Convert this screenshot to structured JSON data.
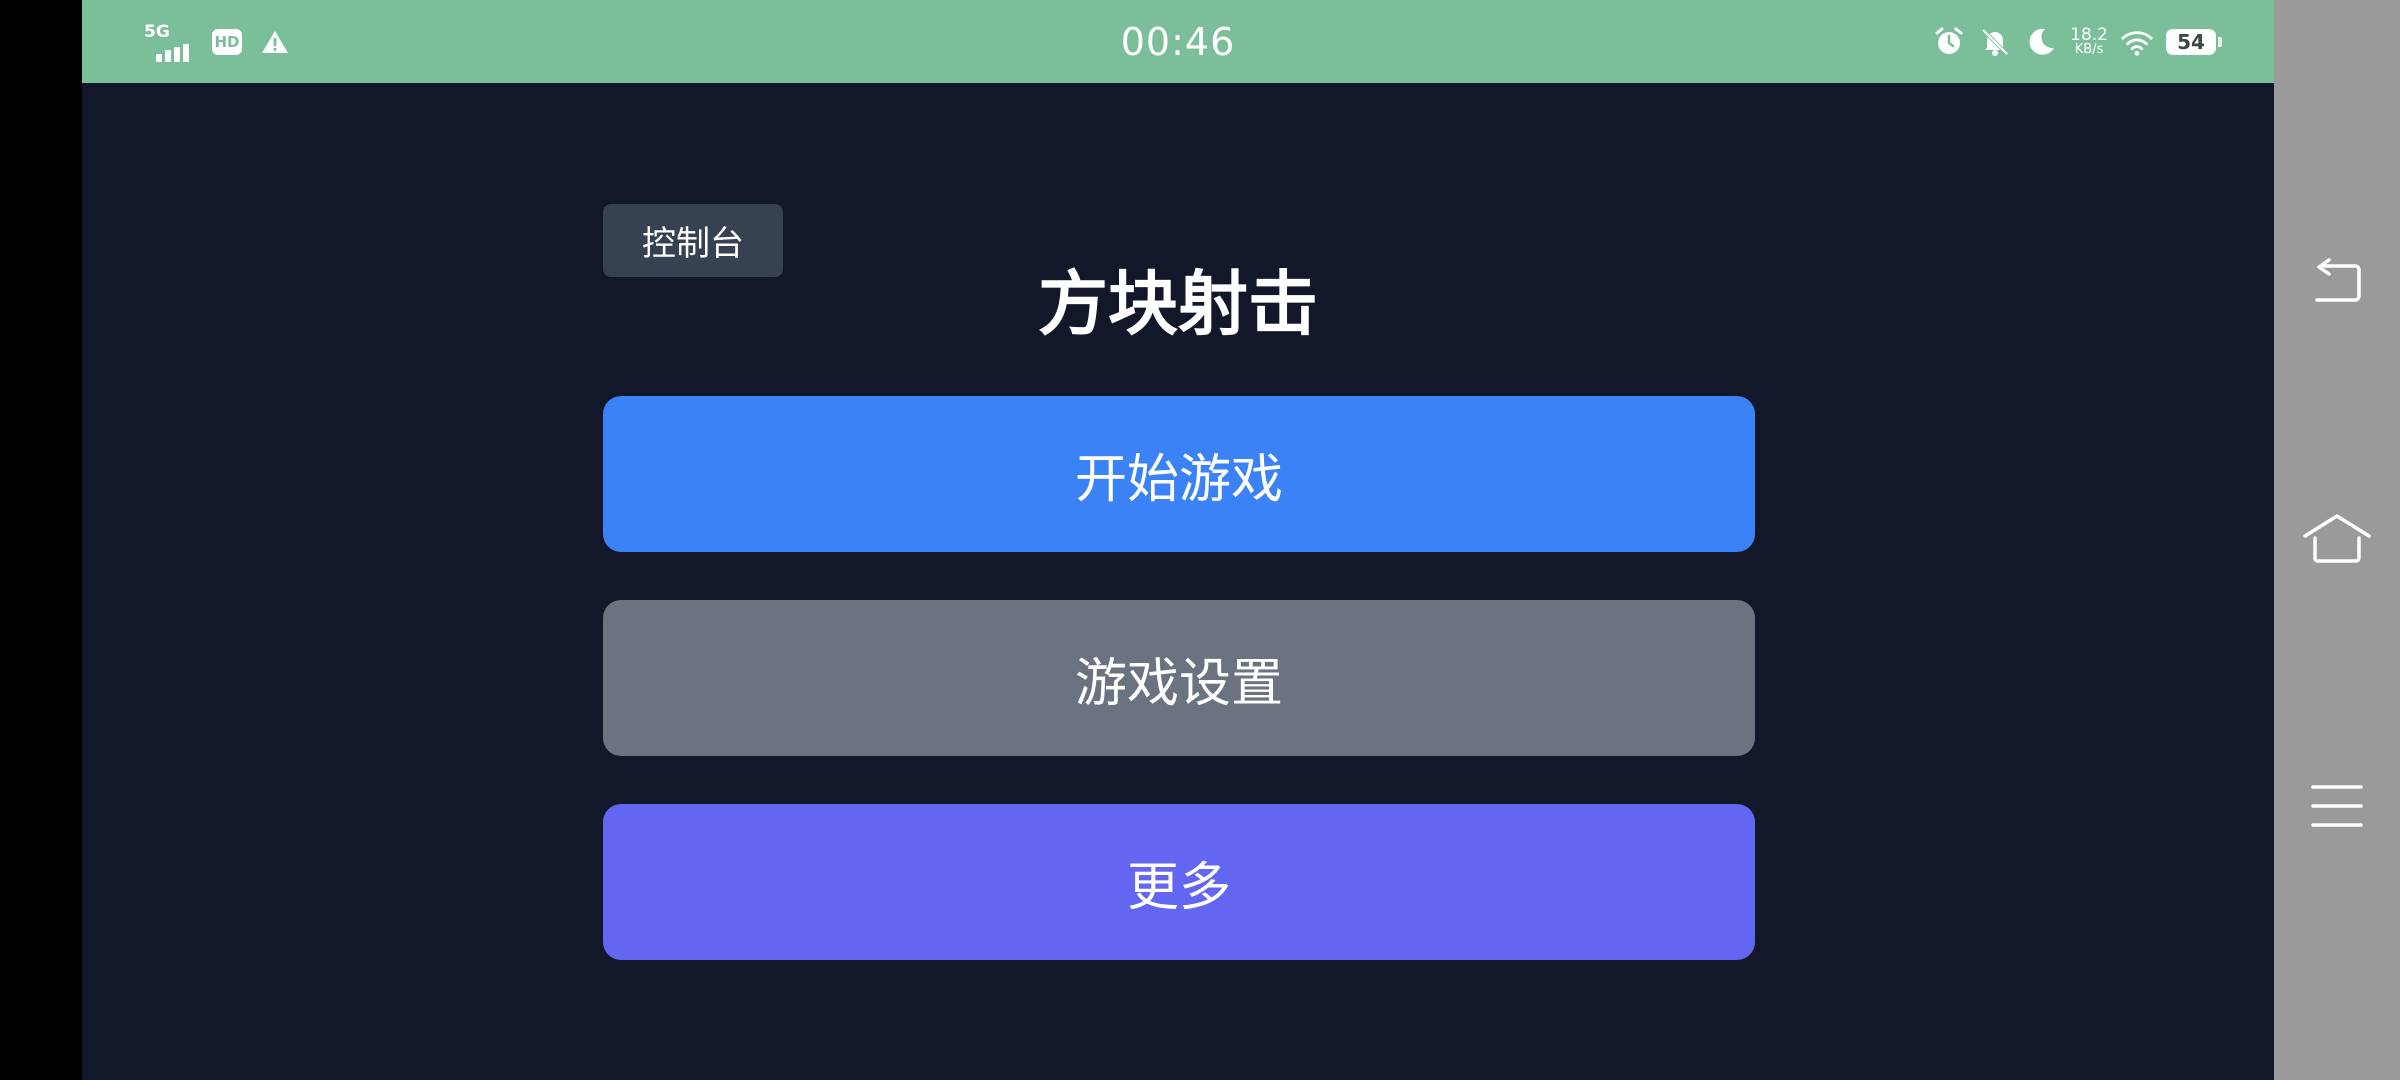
{
  "status_bar": {
    "network": "5G",
    "hd_badge": "HD",
    "time": "00:46",
    "speed_value": "18.2",
    "speed_unit": "KB/s",
    "battery": "54",
    "icons": [
      "signal-icon",
      "hd-icon",
      "warning-icon",
      "alarm-icon",
      "mute-notifications-icon",
      "do-not-disturb-moon-icon",
      "wifi-icon",
      "battery-icon"
    ]
  },
  "app": {
    "console_label": "控制台",
    "title": "方块射击",
    "buttons": {
      "start": "开始游戏",
      "settings": "游戏设置",
      "more": "更多"
    }
  },
  "nav_bar": {
    "icons": [
      "back-icon",
      "home-icon",
      "recents-menu-icon"
    ]
  },
  "colors": {
    "status_bar_bg": "#7abf9a",
    "app_bg": "#121829",
    "console_bg": "#374151",
    "start_button": "#3b82f6",
    "settings_button": "#6b7280",
    "more_button": "#6366f1",
    "nav_bar_bg": "#9a9a9a"
  }
}
